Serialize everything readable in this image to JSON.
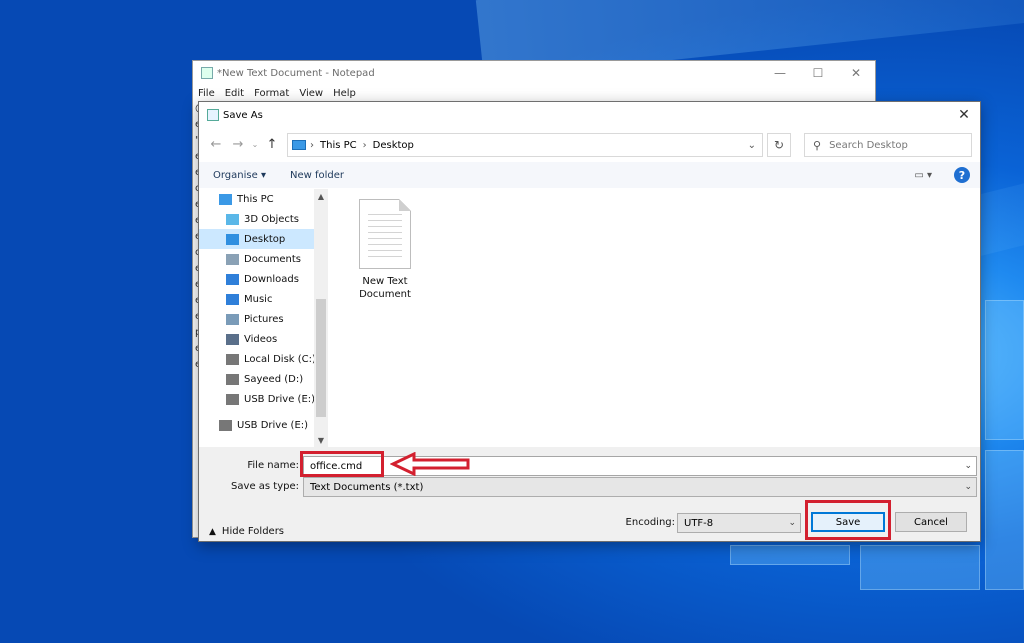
{
  "notepad": {
    "title": "*New Text Document - Notepad",
    "menu": [
      "File",
      "Edit",
      "Format",
      "View",
      "Help"
    ],
    "controls": [
      "—",
      "☐",
      "✕"
    ],
    "gutter_chars": [
      "@",
      "e",
      "\"",
      "e",
      "e",
      "c",
      "e",
      "e",
      "e",
      "c",
      "e",
      "e",
      "e",
      "e",
      "p",
      "e",
      "e"
    ]
  },
  "dialog": {
    "title": "Save As",
    "close": "✕",
    "breadcrumb": [
      "This PC",
      "Desktop"
    ],
    "search_placeholder": "Search Desktop",
    "toolbar": {
      "organise": "Organise ▾",
      "new_folder": "New folder"
    },
    "nav_items": [
      {
        "label": "This PC",
        "icon": "this-pc-icon",
        "color": "#3b99e6"
      },
      {
        "label": "3D Objects",
        "icon": "cube-icon",
        "color": "#5ab7e8"
      },
      {
        "label": "Desktop",
        "icon": "desktop-icon",
        "color": "#2f8fe0",
        "selected": true
      },
      {
        "label": "Documents",
        "icon": "documents-icon",
        "color": "#8aa1b5"
      },
      {
        "label": "Downloads",
        "icon": "download-icon",
        "color": "#2f7fd9"
      },
      {
        "label": "Music",
        "icon": "music-icon",
        "color": "#2f7fd9"
      },
      {
        "label": "Pictures",
        "icon": "pictures-icon",
        "color": "#7a9bb8"
      },
      {
        "label": "Videos",
        "icon": "videos-icon",
        "color": "#5a6f8a"
      },
      {
        "label": "Local Disk (C:)",
        "icon": "disk-icon",
        "color": "#777"
      },
      {
        "label": "Sayeed (D:)",
        "icon": "disk-icon",
        "color": "#777"
      },
      {
        "label": "USB Drive (E:)",
        "icon": "usb-drive-icon",
        "color": "#777"
      },
      {
        "label": "USB Drive (E:)",
        "icon": "usb-drive-icon",
        "color": "#777"
      }
    ],
    "file": {
      "name_line1": "New Text",
      "name_line2": "Document"
    },
    "file_name_label": "File name:",
    "file_name_value": "office.cmd",
    "save_as_type_label": "Save as type:",
    "save_as_type_value": "Text Documents (*.txt)",
    "hide_folders": "Hide Folders",
    "encoding_label": "Encoding:",
    "encoding_value": "UTF-8",
    "save": "Save",
    "cancel": "Cancel"
  },
  "colors": {
    "highlight": "#d3202f",
    "accent": "#0078d7",
    "selection": "#cce8ff"
  }
}
